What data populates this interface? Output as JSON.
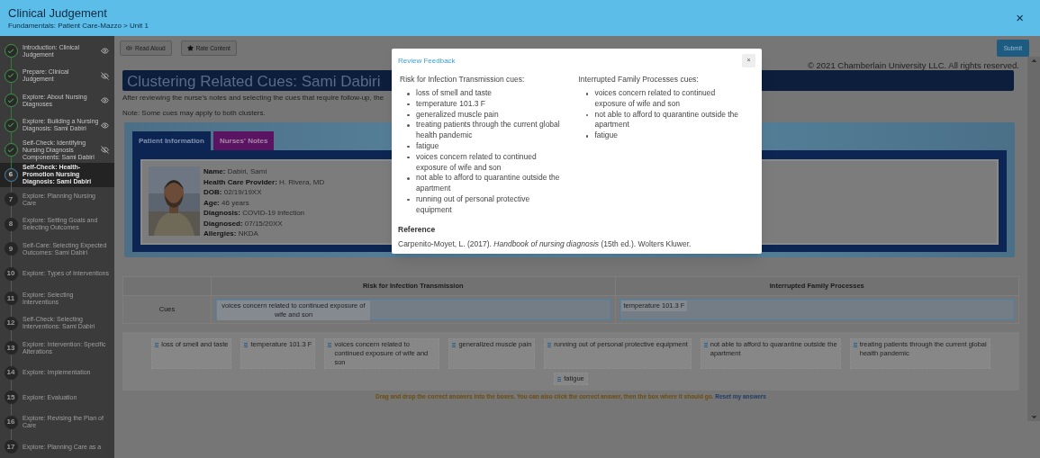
{
  "header": {
    "title": "Clinical Judgement",
    "breadcrumb": "Fundamentals: Patient Care-Mazzo > Unit 1",
    "close": "×"
  },
  "sidebar": {
    "items": [
      {
        "label": "Introduction: Clinical Judgement",
        "kind": "done",
        "hidden": false,
        "selected": false
      },
      {
        "label": "Prepare: Clinical Judgement",
        "kind": "done",
        "hidden": true,
        "selected": false
      },
      {
        "label": "Explore: About Nursing Diagnoses",
        "kind": "done",
        "hidden": false,
        "selected": false
      },
      {
        "label": "Explore: Building a Nursing Diagnosis: Sami Dabiri",
        "kind": "done",
        "hidden": false,
        "selected": false
      },
      {
        "label": "Self-Check: Identifying Nursing Diagnosis Components: Sami Dabiri",
        "kind": "done",
        "hidden": true,
        "selected": false
      },
      {
        "label": "Self-Check: Health-Promotion Nursing Diagnosis: Sami Dabiri",
        "kind": "current",
        "number": "6",
        "selected": true
      },
      {
        "label": "Explore: Planning Nursing Care",
        "kind": "todo",
        "number": "7",
        "selected": false
      },
      {
        "label": "Explore: Setting Goals and Selecting Outcomes",
        "kind": "todo",
        "number": "8",
        "selected": false
      },
      {
        "label": "Self-Care: Selecting Expected Outcomes: Sami Dabiri",
        "kind": "todo",
        "number": "9",
        "selected": false
      },
      {
        "label": "Explore: Types of Interventions",
        "kind": "todo",
        "number": "10",
        "selected": false
      },
      {
        "label": "Explore: Selecting Interventions",
        "kind": "todo",
        "number": "11",
        "selected": false
      },
      {
        "label": "Self-Check: Selecting Interventions: Sami Dabiri",
        "kind": "todo",
        "number": "12",
        "selected": false
      },
      {
        "label": "Explore: Intervention: Specific Alterations",
        "kind": "todo",
        "number": "13",
        "selected": false
      },
      {
        "label": "Explore: Implementation",
        "kind": "todo",
        "number": "14",
        "selected": false
      },
      {
        "label": "Explore: Evaluation",
        "kind": "todo",
        "number": "15",
        "selected": false
      },
      {
        "label": "Explore: Revising the Plan of Care",
        "kind": "todo",
        "number": "16",
        "selected": false
      },
      {
        "label": "Explore: Planning Care as a",
        "kind": "todo",
        "number": "17",
        "selected": false
      }
    ]
  },
  "toolbar": {
    "buttons": [
      {
        "label": "Read Aloud",
        "kind": "speaker"
      },
      {
        "label": "Rate Content",
        "kind": "star"
      }
    ],
    "submit": "Submit"
  },
  "copyright": "© 2021 Chamberlain University LLC. All rights reserved.",
  "page": {
    "heading": "Clustering Related Cues: Sami Dabiri",
    "intro": "After reviewing the nurse's notes and selecting the cues that require follow-up, the",
    "note": "Note: Some cues may apply to both clusters."
  },
  "patient": {
    "tabs": [
      {
        "label": "Patient Information",
        "selected": true
      },
      {
        "label": "Nurses' Notes",
        "selected": false
      }
    ],
    "fields": [
      {
        "label": "Name:",
        "value": "Dabiri, Sami"
      },
      {
        "label": "Health Care Provider:",
        "value": "H. Rivera, MD"
      },
      {
        "label": "DOB:",
        "value": "02/19/19XX"
      },
      {
        "label": "Age:",
        "value": "46 years"
      },
      {
        "label": "Diagnosis:",
        "value": "COVID-19 infection"
      },
      {
        "label": "Diagnosed:",
        "value": "07/15/20XX"
      },
      {
        "label": "Allergies:",
        "value": "NKDA"
      }
    ]
  },
  "matching": {
    "columns": [
      "Risk for Infection Transmission",
      "Interrupted Family Processes"
    ],
    "row_label": "Cues",
    "drops": [
      [
        "voices concern related to continued exposure of wife and son"
      ],
      [
        "temperature 101.3 F"
      ]
    ],
    "pool": [
      "loss of smell and taste",
      "temperature 101.3 F",
      "voices concern related to continued exposure of wife and son",
      "generalized muscle pain",
      "running out of personal protective equipment",
      "not able to afford to quarantine outside the apartment",
      "treating patients through the current global health pandemic",
      "fatigue"
    ],
    "instruction": "Drag and drop the correct answers into the boxes. You can also click the correct answer, then the box where it should go.",
    "reset": "Reset my answers"
  },
  "modal": {
    "title": "Review Feedback",
    "close": "×",
    "columns": [
      {
        "heading": "Risk for Infection Transmission cues:",
        "items": [
          "loss of smell and taste",
          "temperature 101.3 F",
          "generalized muscle pain",
          "treating patients through the current global health pandemic",
          "fatigue",
          "voices concern related to continued exposure of wife and son",
          "not able to afford to quarantine outside the apartment",
          "running out of personal protective equipment"
        ]
      },
      {
        "heading": "Interrupted Family Processes cues:",
        "items": [
          "voices concern related to continued exposure of wife and son",
          "not able to afford to quarantine outside the apartment",
          "fatigue"
        ]
      }
    ],
    "reference_heading": "Reference",
    "citation": "Carpenito-Moyet, L. (2017). *Handbook of nursing diagnosis* (15th ed.). Wolters Kluwer."
  }
}
